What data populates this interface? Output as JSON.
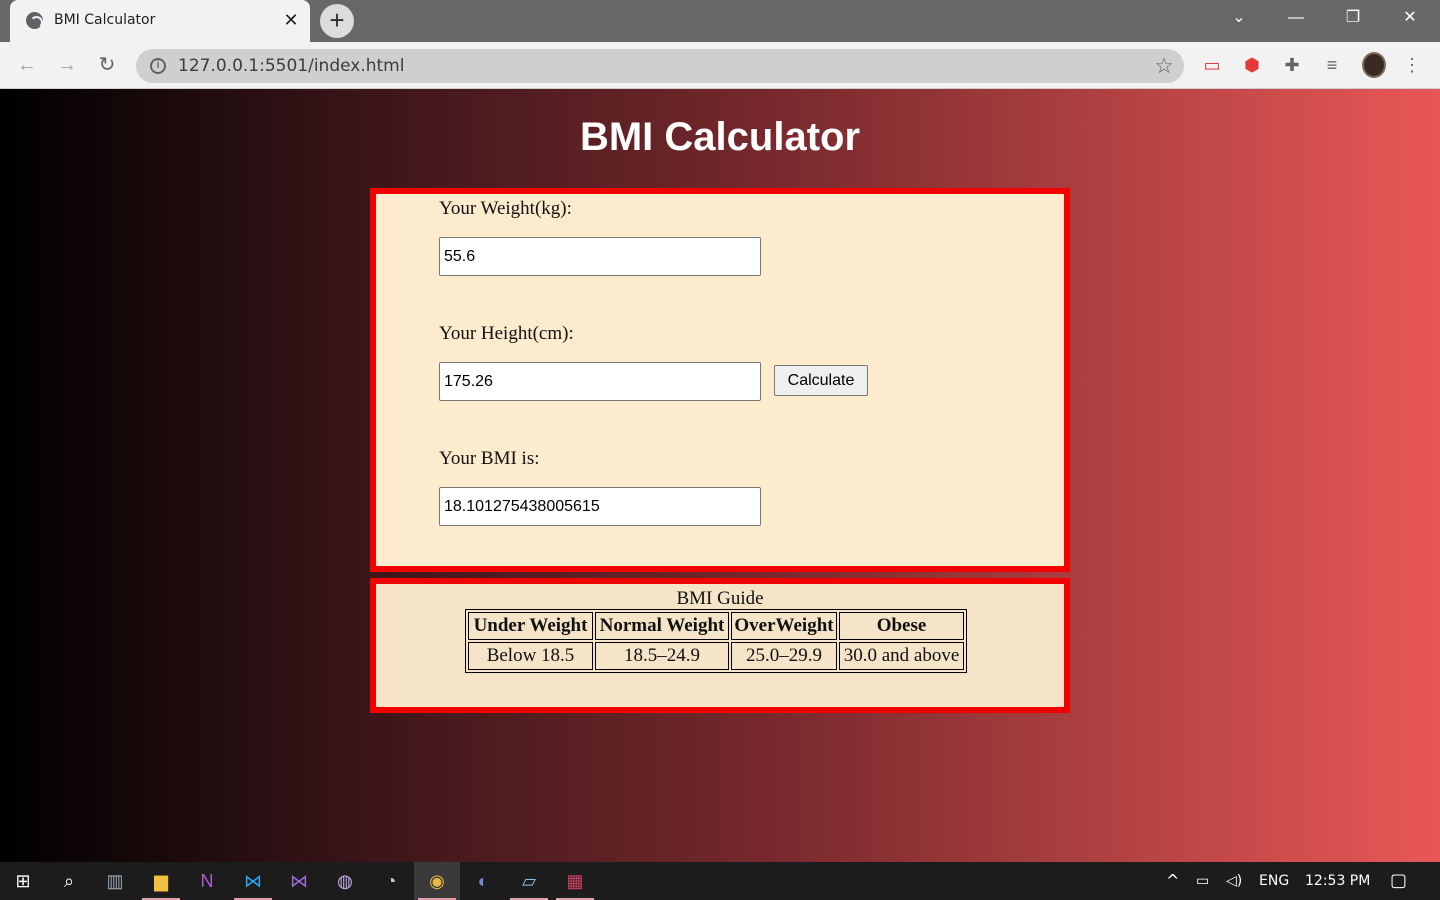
{
  "browser": {
    "tab_title": "BMI Calculator",
    "url": "127.0.0.1:5501/index.html"
  },
  "page": {
    "title": "BMI Calculator",
    "weight": {
      "label": "Your Weight(kg):",
      "value": "55.6"
    },
    "height": {
      "label": "Your Height(cm):",
      "value": "175.26"
    },
    "calculate_label": "Calculate",
    "bmi": {
      "label": "Your BMI is:",
      "value": "18.101275438005615"
    },
    "guide": {
      "caption": "BMI Guide",
      "headers": [
        "Under Weight",
        "Normal Weight",
        "OverWeight",
        "Obese"
      ],
      "values": [
        "Below 18.5",
        "18.5–24.9",
        "25.0–29.9",
        "30.0 and above"
      ]
    }
  },
  "taskbar": {
    "language": "ENG",
    "time": "12:53 PM"
  },
  "colors": {
    "form_bg": "#fdebcd",
    "guide_bg": "#f5e4c8",
    "border": "#f20000",
    "gradient_start": "#000000",
    "gradient_end": "#e95757"
  }
}
